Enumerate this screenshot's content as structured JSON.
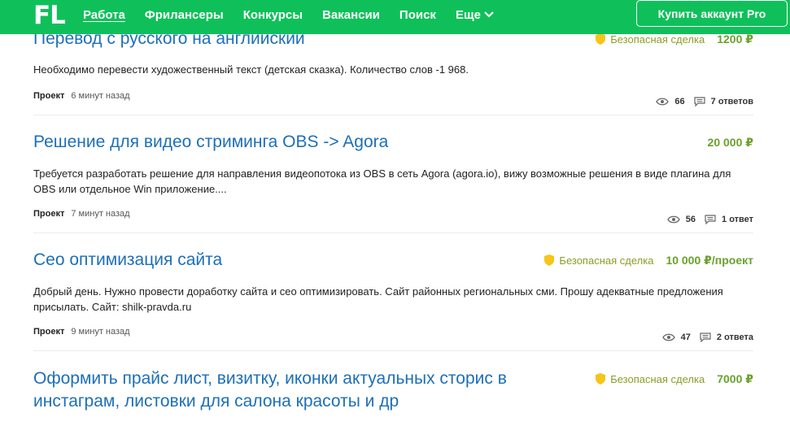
{
  "header": {
    "logo": "FL",
    "nav": [
      "Работа",
      "Фрилансеры",
      "Конкурсы",
      "Вакансии",
      "Поиск",
      "Еще"
    ],
    "pro_button": "Купить аккаунт Pro",
    "bg_color": "#0fc05a"
  },
  "projects": [
    {
      "title": "Перевод с русского на английский",
      "safe_deal": "Безопасная сделка",
      "price": "1200 ₽",
      "description": "Необходимо перевести художественный текст (детская сказка). Количество слов -1 968.",
      "type": "Проект",
      "time": "6 минут назад",
      "views": "66",
      "answers": "7 ответов"
    },
    {
      "title": "Решение для видео стриминга OBS -> Agora",
      "price": "20 000 ₽",
      "description": "Требуется разработать решение для направления видеопотока из OBS в сеть Agora (agora.io), вижу возможные решения в виде плагина для OBS или отдельное Win приложение....",
      "type": "Проект",
      "time": "7 минут назад",
      "views": "56",
      "answers": "1 ответ"
    },
    {
      "title": "Сео оптимизация сайта",
      "safe_deal": "Безопасная сделка",
      "price": "10 000 ₽/проект",
      "description": "Добрый день. Нужно провести доработку сайта и сео оптимизировать. Сайт районных региональных сми. Прошу адекватные предложения присылать. Сайт: shilk-pravda.ru",
      "type": "Проект",
      "time": "9 минут назад",
      "views": "47",
      "answers": "2 ответа"
    },
    {
      "title": "Оформить прайс лист, визитку, иконки актуальных сторис в инстаграм, листовки для салона красоты и др",
      "safe_deal": "Безопасная сделка",
      "price": "7000 ₽"
    }
  ]
}
